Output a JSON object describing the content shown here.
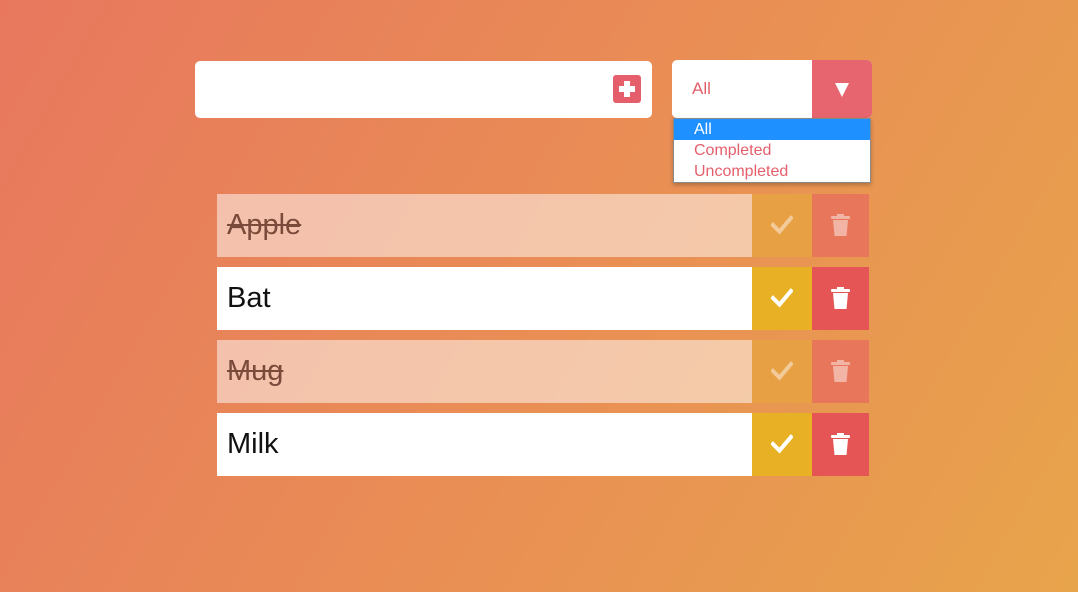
{
  "todo_input": {
    "value": "",
    "placeholder": ""
  },
  "filter": {
    "selected": "All",
    "options": [
      "All",
      "Completed",
      "Uncompleted"
    ]
  },
  "todos": [
    {
      "text": "Apple",
      "completed": true
    },
    {
      "text": "Bat",
      "completed": false
    },
    {
      "text": "Mug",
      "completed": true
    },
    {
      "text": "Milk",
      "completed": false
    }
  ],
  "colors": {
    "accent": "#e45f6b",
    "complete_button": "#e8b024",
    "trash_button": "#e55555",
    "dropdown_highlight": "#1e90ff"
  },
  "icons": {
    "add": "plus-square-icon",
    "dropdown": "caret-down-icon",
    "complete": "check-icon",
    "delete": "trash-icon"
  }
}
